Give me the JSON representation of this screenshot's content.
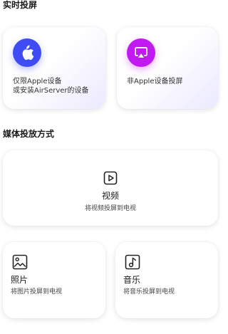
{
  "realtime": {
    "title": "实时投屏",
    "apple": {
      "line1": "仅限Apple设备",
      "line2": "或安装AirServer的设备",
      "icon": "apple-icon",
      "color": "#3f4cf3"
    },
    "non_apple": {
      "label": "非Apple设备投屏",
      "icon": "airplay-icon",
      "color": "#c11af0"
    }
  },
  "media": {
    "title": "媒体投放方式",
    "video": {
      "label": "视频",
      "desc": "将视频投屏到电视",
      "icon": "video-play-icon"
    },
    "photo": {
      "label": "照片",
      "desc": "将图片投屏到电视",
      "icon": "image-icon"
    },
    "music": {
      "label": "音乐",
      "desc": "将音乐投屏到电视",
      "icon": "music-note-icon"
    }
  }
}
